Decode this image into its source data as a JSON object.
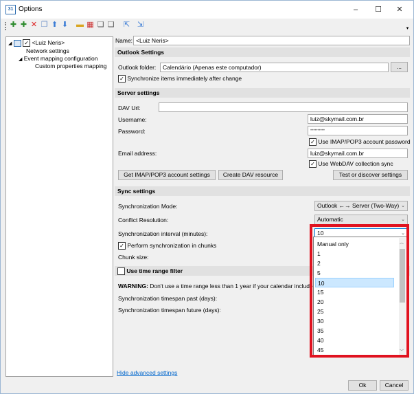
{
  "window": {
    "title": "Options",
    "minimize": "–",
    "maximize": "☐",
    "close": "✕"
  },
  "toolbar": {
    "icons": [
      "add-icon",
      "add-child-icon",
      "delete-icon",
      "copy-icon",
      "move-up-icon",
      "move-down-icon",
      "folder-icon",
      "clear-cache-icon",
      "copy-settings-icon",
      "paste-settings-icon",
      "export-icon",
      "import-icon"
    ],
    "overflow": "▾"
  },
  "tree": {
    "root": "<Luiz Neris>",
    "items": [
      "Network settings",
      "Event mapping configuration",
      "Custom properties mapping"
    ]
  },
  "profile": {
    "name_label": "Name:",
    "name_value": "<Luiz Neris>"
  },
  "outlook": {
    "header": "Outlook Settings",
    "folder_label": "Outlook folder:",
    "folder_value": "Calendário (Apenas este computador)",
    "browse": "...",
    "sync_changed": "Synchronize items immediately after change"
  },
  "server": {
    "header": "Server settings",
    "dav_label": "DAV Url:",
    "dav_value": "",
    "username_label": "Username:",
    "username_value": "luiz@skymail.com.br",
    "password_label": "Password:",
    "password_value": "••••••••••",
    "use_imap": "Use IMAP/POP3 account password",
    "email_label": "Email address:",
    "email_value": "luiz@skymail.com.br",
    "use_webdav": "Use WebDAV collection sync",
    "btn_imap": "Get IMAP/POP3 account settings",
    "btn_dav": "Create DAV resource",
    "btn_test": "Test or discover settings"
  },
  "sync": {
    "header": "Sync settings",
    "mode_label": "Synchronization Mode:",
    "mode_value": "Outlook ←→ Server (Two-Way)",
    "conflict_label": "Conflict Resolution:",
    "conflict_value": "Automatic",
    "interval_label": "Synchronization interval (minutes):",
    "interval_value": "10",
    "chunks": "Perform synchronization in chunks",
    "chunk_size_label": "Chunk size:",
    "interval_options": [
      "Manual only",
      "1",
      "2",
      "5",
      "10",
      "15",
      "20",
      "25",
      "30",
      "35",
      "40",
      "45"
    ],
    "selected_option": "10"
  },
  "timerange": {
    "header": "Use time range filter",
    "warning_bold": "WARNING:",
    "warning_text": " Don't use a time range less than 1 year if your calendar include",
    "past_label": "Synchronization timespan past (days):",
    "future_label": "Synchronization timespan future (days):"
  },
  "footer": {
    "hide_advanced": "Hide advanced settings",
    "ok": "Ok",
    "cancel": "Cancel"
  },
  "colors": {
    "highlight": "#e0121f",
    "selected": "#cce8ff",
    "link": "#0066cc"
  }
}
